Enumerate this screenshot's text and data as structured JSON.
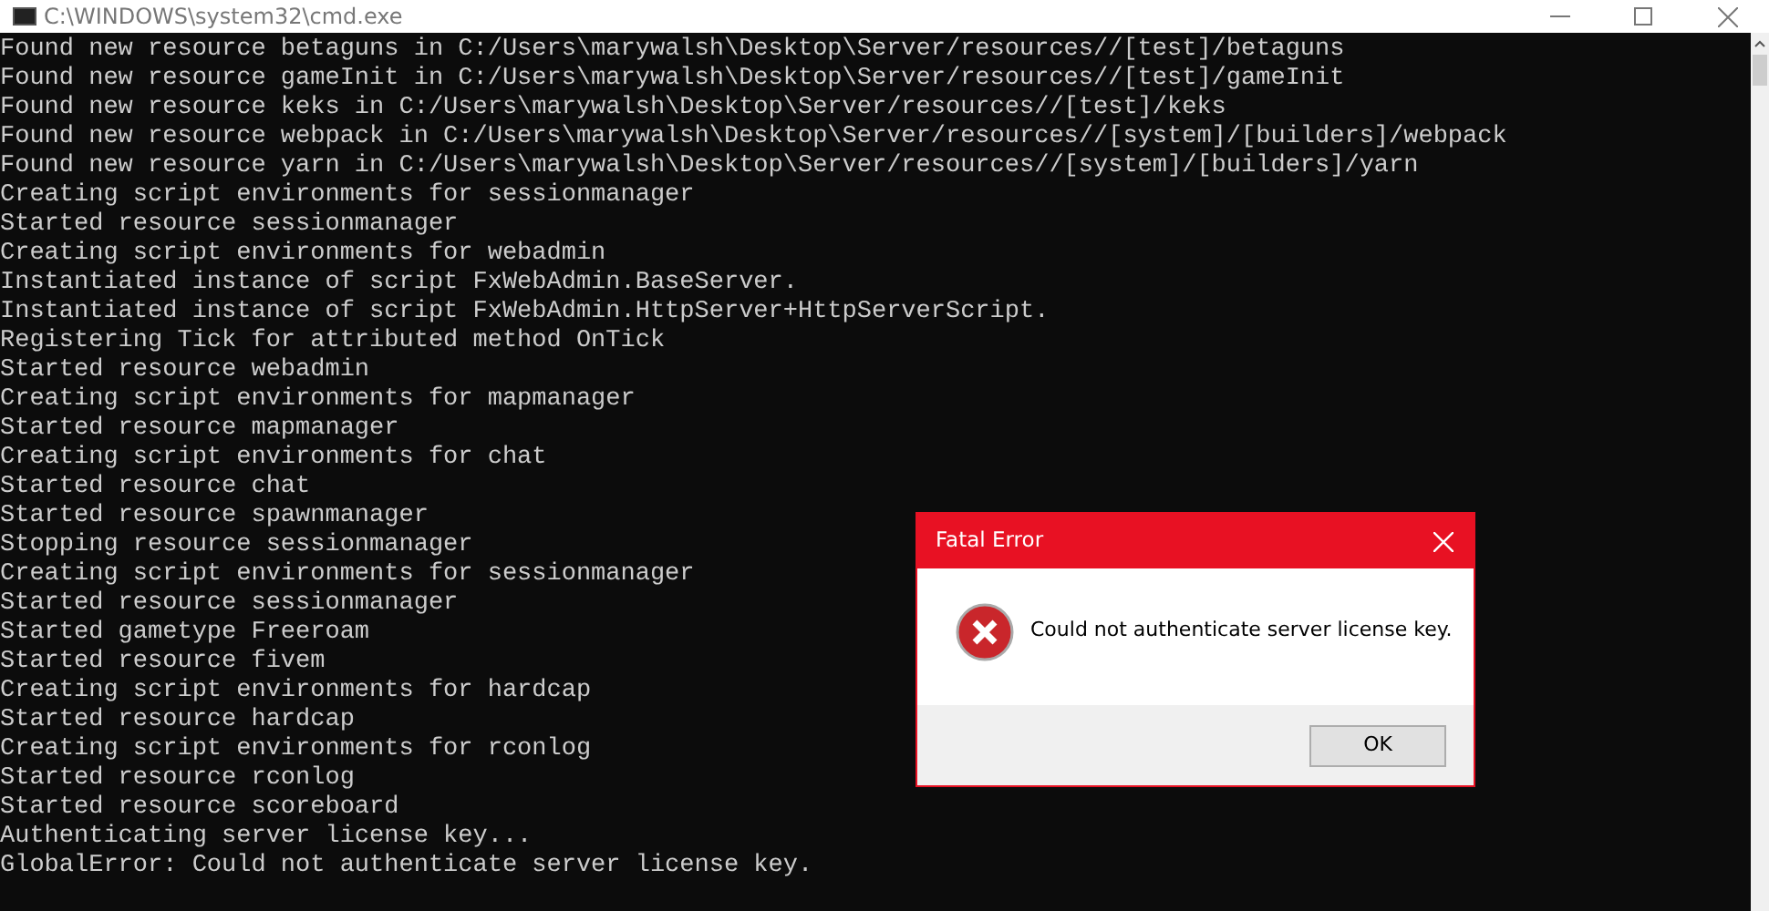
{
  "window": {
    "title": "C:\\WINDOWS\\system32\\cmd.exe"
  },
  "console_lines": [
    "Found new resource betaguns in C:/Users\\marywalsh\\Desktop\\Server/resources//[test]/betaguns",
    "Found new resource gameInit in C:/Users\\marywalsh\\Desktop\\Server/resources//[test]/gameInit",
    "Found new resource keks in C:/Users\\marywalsh\\Desktop\\Server/resources//[test]/keks",
    "Found new resource webpack in C:/Users\\marywalsh\\Desktop\\Server/resources//[system]/[builders]/webpack",
    "Found new resource yarn in C:/Users\\marywalsh\\Desktop\\Server/resources//[system]/[builders]/yarn",
    "Creating script environments for sessionmanager",
    "Started resource sessionmanager",
    "Creating script environments for webadmin",
    "Instantiated instance of script FxWebAdmin.BaseServer.",
    "Instantiated instance of script FxWebAdmin.HttpServer+HttpServerScript.",
    "Registering Tick for attributed method OnTick",
    "Started resource webadmin",
    "Creating script environments for mapmanager",
    "Started resource mapmanager",
    "Creating script environments for chat",
    "Started resource chat",
    "Started resource spawnmanager",
    "Stopping resource sessionmanager",
    "Creating script environments for sessionmanager",
    "Started resource sessionmanager",
    "Started gametype Freeroam",
    "Started resource fivem",
    "Creating script environments for hardcap",
    "Started resource hardcap",
    "Creating script environments for rconlog",
    "Started resource rconlog",
    "Started resource scoreboard",
    "Authenticating server license key...",
    "GlobalError: Could not authenticate server license key."
  ],
  "dialog": {
    "title": "Fatal Error",
    "message": "Could not authenticate server license key.",
    "buttons": [
      "OK"
    ]
  }
}
